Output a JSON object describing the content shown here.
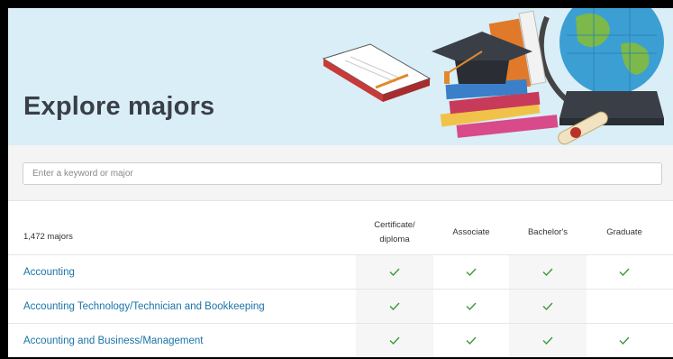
{
  "hero": {
    "title": "Explore majors"
  },
  "search": {
    "placeholder": "Enter a keyword or major",
    "value": ""
  },
  "table": {
    "count_label": "1,472 majors",
    "columns": [
      "Certificate/\ndiploma",
      "Associate",
      "Bachelor's",
      "Graduate"
    ],
    "rows": [
      {
        "name": "Accounting",
        "certificate": true,
        "associate": true,
        "bachelors": true,
        "graduate": true
      },
      {
        "name": "Accounting Technology/Technician and Bookkeeping",
        "certificate": true,
        "associate": true,
        "bachelors": true,
        "graduate": false
      },
      {
        "name": "Accounting and Business/Management",
        "certificate": true,
        "associate": true,
        "bachelors": true,
        "graduate": true
      }
    ]
  },
  "colors": {
    "hero_bg": "#d9eef7",
    "link": "#1a73a8",
    "check": "#3a9a3a"
  },
  "icons": [
    "check-icon",
    "books-globe-illustration"
  ]
}
